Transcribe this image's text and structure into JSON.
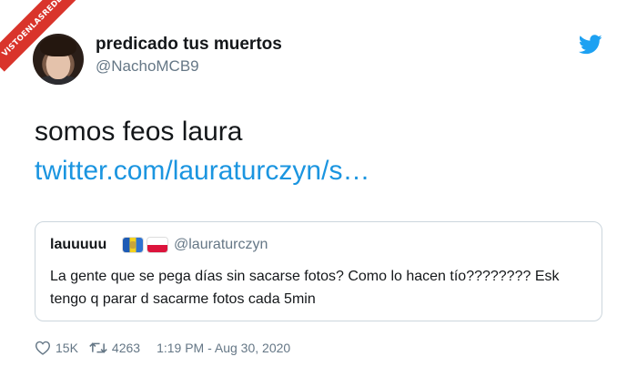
{
  "watermark": {
    "text": "VISTOENLASREDES"
  },
  "author": {
    "display_name": "predicado tus muertos",
    "handle": "@NachoMCB9"
  },
  "icons": {
    "platform": "twitter-bird-icon",
    "like": "heart-icon",
    "retweet": "retweet-icon",
    "brand_color": "#1da1f2"
  },
  "tweet": {
    "text": "somos feos laura",
    "link_text": "twitter.com/lauraturczyn/s…",
    "link_color": "#1b95e0"
  },
  "quoted_tweet": {
    "display_name": "lauuuuu",
    "flags": [
      "canary-islands-flag",
      "poland-flag"
    ],
    "handle": "@lauraturczyn",
    "text": "La gente que se pega días sin sacarse fotos? Como lo hacen tío???????? Esk tengo q parar d sacarme fotos cada 5min"
  },
  "footer": {
    "likes": "15K",
    "retweets": "4263",
    "timestamp": "1:19 PM - Aug 30, 2020"
  }
}
